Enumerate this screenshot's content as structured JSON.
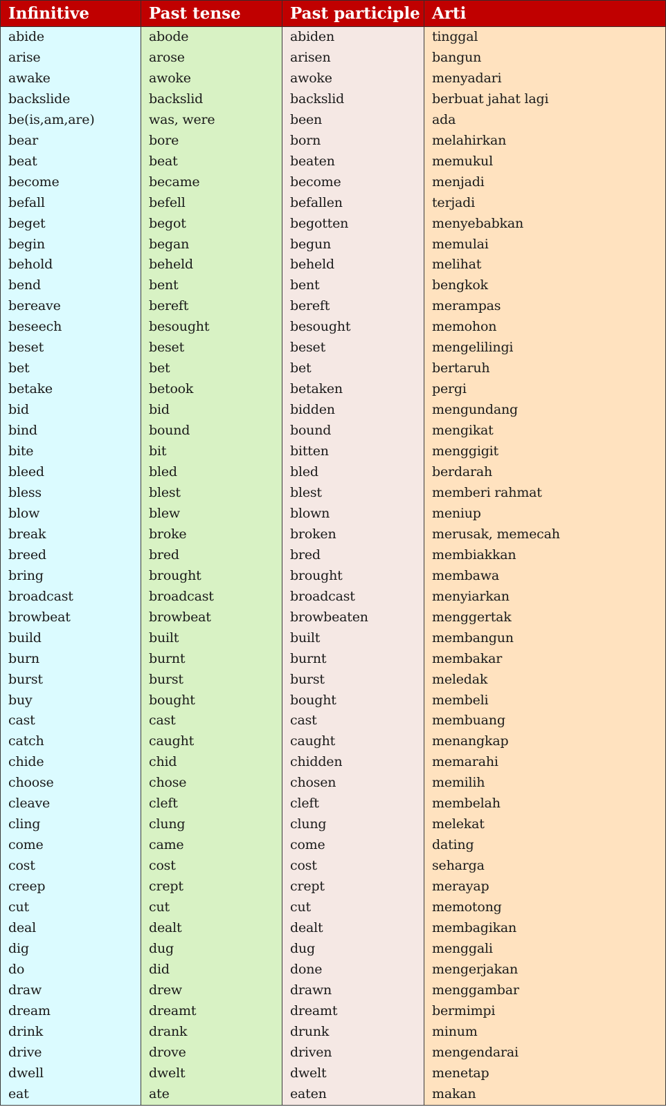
{
  "table": {
    "headers": {
      "infinitive": "Infinitive",
      "past_tense": "Past tense",
      "past_participle": "Past participle",
      "arti": "Arti"
    },
    "colors": {
      "header_bg": "#c00000",
      "header_text": "#ffffff",
      "infinitive_bg": "#dbfbff",
      "past_tense_bg": "#d8f2c4",
      "past_participle_bg": "#f5e8e4",
      "arti_bg": "#ffe2bf"
    },
    "rows": [
      {
        "infinitive": "abide",
        "past_tense": "abode",
        "past_participle": "abiden",
        "arti": "tinggal"
      },
      {
        "infinitive": "arise",
        "past_tense": "arose",
        "past_participle": "arisen",
        "arti": "bangun"
      },
      {
        "infinitive": "awake",
        "past_tense": "awoke",
        "past_participle": "awoke",
        "arti": "menyadari"
      },
      {
        "infinitive": "backslide",
        "past_tense": "backslid",
        "past_participle": "backslid",
        "arti": "berbuat jahat lagi"
      },
      {
        "infinitive": "be(is,am,are)",
        "past_tense": "was, were",
        "past_participle": "been",
        "arti": "ada"
      },
      {
        "infinitive": "bear",
        "past_tense": "bore",
        "past_participle": "born",
        "arti": "melahirkan"
      },
      {
        "infinitive": "beat",
        "past_tense": "beat",
        "past_participle": "beaten",
        "arti": "memukul"
      },
      {
        "infinitive": "become",
        "past_tense": "became",
        "past_participle": "become",
        "arti": "menjadi"
      },
      {
        "infinitive": "befall",
        "past_tense": "befell",
        "past_participle": "befallen",
        "arti": "terjadi"
      },
      {
        "infinitive": "beget",
        "past_tense": "begot",
        "past_participle": "begotten",
        "arti": "menyebabkan"
      },
      {
        "infinitive": "begin",
        "past_tense": "began",
        "past_participle": "begun",
        "arti": "memulai"
      },
      {
        "infinitive": "behold",
        "past_tense": "beheld",
        "past_participle": "beheld",
        "arti": "melihat"
      },
      {
        "infinitive": "bend",
        "past_tense": "bent",
        "past_participle": "bent",
        "arti": "bengkok"
      },
      {
        "infinitive": "bereave",
        "past_tense": "bereft",
        "past_participle": "bereft",
        "arti": "merampas"
      },
      {
        "infinitive": "beseech",
        "past_tense": "besought",
        "past_participle": "besought",
        "arti": "memohon"
      },
      {
        "infinitive": "beset",
        "past_tense": "beset",
        "past_participle": "beset",
        "arti": "mengelilingi"
      },
      {
        "infinitive": "bet",
        "past_tense": "bet",
        "past_participle": "bet",
        "arti": "bertaruh"
      },
      {
        "infinitive": "betake",
        "past_tense": "betook",
        "past_participle": "betaken",
        "arti": "pergi"
      },
      {
        "infinitive": "bid",
        "past_tense": "bid",
        "past_participle": "bidden",
        "arti": "mengundang"
      },
      {
        "infinitive": "bind",
        "past_tense": "bound",
        "past_participle": "bound",
        "arti": "mengikat"
      },
      {
        "infinitive": "bite",
        "past_tense": "bit",
        "past_participle": "bitten",
        "arti": "menggigit"
      },
      {
        "infinitive": "bleed",
        "past_tense": "bled",
        "past_participle": "bled",
        "arti": "berdarah"
      },
      {
        "infinitive": "bless",
        "past_tense": "blest",
        "past_participle": "blest",
        "arti": "memberi rahmat"
      },
      {
        "infinitive": "blow",
        "past_tense": "blew",
        "past_participle": "blown",
        "arti": "meniup"
      },
      {
        "infinitive": "break",
        "past_tense": "broke",
        "past_participle": "broken",
        "arti": "merusak, memecah"
      },
      {
        "infinitive": "breed",
        "past_tense": "bred",
        "past_participle": "bred",
        "arti": "membiakkan"
      },
      {
        "infinitive": "bring",
        "past_tense": "brought",
        "past_participle": "brought",
        "arti": "membawa"
      },
      {
        "infinitive": "broadcast",
        "past_tense": "broadcast",
        "past_participle": "broadcast",
        "arti": "menyiarkan"
      },
      {
        "infinitive": "browbeat",
        "past_tense": "browbeat",
        "past_participle": "browbeaten",
        "arti": "menggertak"
      },
      {
        "infinitive": "build",
        "past_tense": "built",
        "past_participle": "built",
        "arti": "membangun"
      },
      {
        "infinitive": "burn",
        "past_tense": "burnt",
        "past_participle": "burnt",
        "arti": "membakar"
      },
      {
        "infinitive": "burst",
        "past_tense": "burst",
        "past_participle": "burst",
        "arti": "meledak"
      },
      {
        "infinitive": "buy",
        "past_tense": "bought",
        "past_participle": "bought",
        "arti": "membeli"
      },
      {
        "infinitive": "cast",
        "past_tense": "cast",
        "past_participle": "cast",
        "arti": "membuang"
      },
      {
        "infinitive": "catch",
        "past_tense": "caught",
        "past_participle": "caught",
        "arti": "menangkap"
      },
      {
        "infinitive": "chide",
        "past_tense": "chid",
        "past_participle": "chidden",
        "arti": "memarahi"
      },
      {
        "infinitive": "choose",
        "past_tense": "chose",
        "past_participle": "chosen",
        "arti": "memilih"
      },
      {
        "infinitive": "cleave",
        "past_tense": "cleft",
        "past_participle": "cleft",
        "arti": "membelah"
      },
      {
        "infinitive": "cling",
        "past_tense": "clung",
        "past_participle": "clung",
        "arti": "melekat"
      },
      {
        "infinitive": "come",
        "past_tense": "came",
        "past_participle": "come",
        "arti": "dating"
      },
      {
        "infinitive": "cost",
        "past_tense": "cost",
        "past_participle": "cost",
        "arti": "seharga"
      },
      {
        "infinitive": "creep",
        "past_tense": "crept",
        "past_participle": "crept",
        "arti": "merayap"
      },
      {
        "infinitive": "cut",
        "past_tense": "cut",
        "past_participle": "cut",
        "arti": "memotong"
      },
      {
        "infinitive": "deal",
        "past_tense": "dealt",
        "past_participle": "dealt",
        "arti": "membagikan"
      },
      {
        "infinitive": "dig",
        "past_tense": "dug",
        "past_participle": "dug",
        "arti": "menggali"
      },
      {
        "infinitive": "do",
        "past_tense": "did",
        "past_participle": "done",
        "arti": "mengerjakan"
      },
      {
        "infinitive": "draw",
        "past_tense": "drew",
        "past_participle": "drawn",
        "arti": "menggambar"
      },
      {
        "infinitive": "dream",
        "past_tense": "dreamt",
        "past_participle": "dreamt",
        "arti": "bermimpi"
      },
      {
        "infinitive": "drink",
        "past_tense": "drank",
        "past_participle": "drunk",
        "arti": "minum"
      },
      {
        "infinitive": "drive",
        "past_tense": "drove",
        "past_participle": "driven",
        "arti": "mengendarai"
      },
      {
        "infinitive": "dwell",
        "past_tense": "dwelt",
        "past_participle": "dwelt",
        "arti": "menetap"
      },
      {
        "infinitive": "eat",
        "past_tense": "ate",
        "past_participle": "eaten",
        "arti": "makan"
      }
    ]
  }
}
